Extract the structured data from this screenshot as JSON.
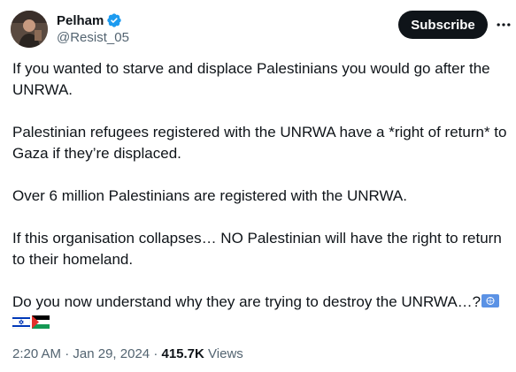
{
  "author": {
    "display_name": "Pelham",
    "handle": "@Resist_05",
    "verified": true,
    "verified_color": "#1d9bf0"
  },
  "actions": {
    "subscribe_label": "Subscribe",
    "more_icon": "more-horizontal-icon"
  },
  "tweet": {
    "paragraphs": [
      "If you wanted to starve and displace Palestinians you would go after the UNRWA.",
      "Palestinian refugees registered with the UNRWA have a *right of return* to Gaza if they’re displaced.",
      "Over 6 million Palestinians are registered with the UNRWA.",
      "If this organisation collapses… NO Palestinian will have the right to return to their homeland.",
      "Do you now understand why they are trying to destroy the UNRWA…?"
    ],
    "emojis": [
      "united-nations-flag",
      "israel-flag",
      "palestine-flag"
    ]
  },
  "meta": {
    "time": "2:20 AM",
    "separator": "·",
    "date": "Jan 29, 2024",
    "views_count": "415.7K",
    "views_label": "Views"
  },
  "colors": {
    "text": "#0f1419",
    "secondary": "#536471",
    "button_bg": "#0f1419",
    "button_text": "#ffffff"
  }
}
